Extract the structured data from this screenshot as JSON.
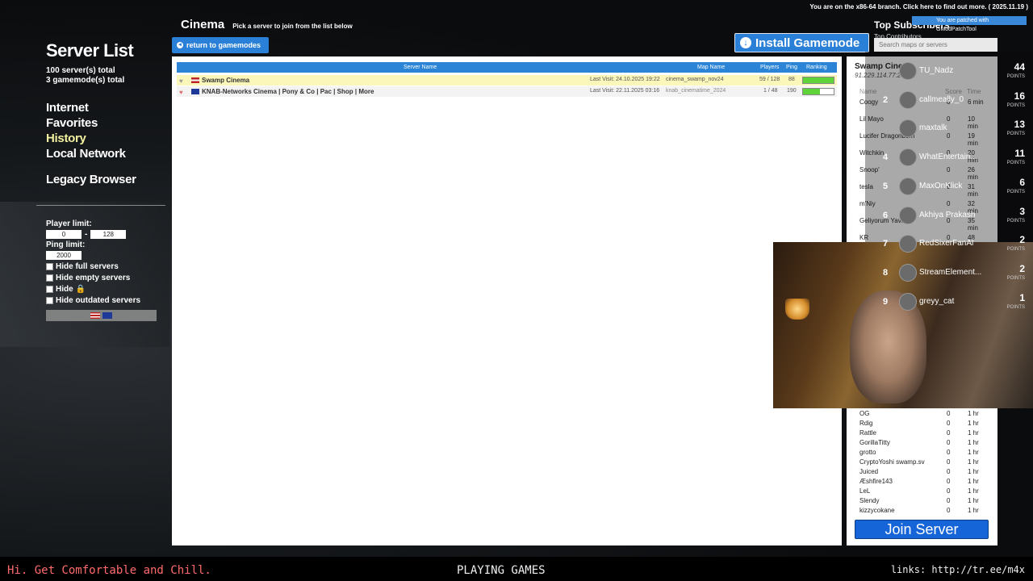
{
  "branch_notice": "You are on the x86-64 branch. Click here to find out more. ( 2025.11.19 )",
  "patched_notice": "You are patched with GModPatchTool",
  "sidebar": {
    "title": "Server List",
    "servers_total": "100 server(s) total",
    "gamemodes_total": "3 gamemode(s) total",
    "nav": [
      "Internet",
      "Favorites",
      "History",
      "Local Network"
    ],
    "active": "History",
    "legacy": "Legacy Browser"
  },
  "filters": {
    "player_limit_label": "Player limit:",
    "player_min": "0",
    "player_max": "128",
    "ping_limit_label": "Ping limit:",
    "ping_value": "2000",
    "options": [
      "Hide full servers",
      "Hide empty servers",
      "Hide",
      "Hide outdated servers"
    ]
  },
  "header": {
    "gamemode": "Cinema",
    "hint": "Pick a server to join from the list below",
    "return_label": "return to gamemodes",
    "install_label": "Install Gamemode"
  },
  "table": {
    "columns": {
      "name": "Server Name",
      "map": "Map Name",
      "players": "Players",
      "ping": "Ping",
      "ranking": "Ranking"
    },
    "rows": [
      {
        "name": "Swamp Cinema",
        "last_visit": "Last Visit: 24.10.2025 19:22",
        "map": "cinema_swamp_nov24",
        "players": "59 / 128",
        "ping": "88",
        "rank": 1.0
      },
      {
        "name": "KNAB-Networks Cinema | Pony & Co | Pac | Shop | More",
        "last_visit": "Last Visit: 22.11.2025 03:16",
        "map": "knab_cinematime_2024",
        "players": "1 / 48",
        "ping": "190",
        "rank": 0.55
      }
    ]
  },
  "server_panel": {
    "title": "Swamp Cinema",
    "ip": "91.229.114.77:27015",
    "columns": {
      "name": "Name",
      "score": "Score",
      "time": "Time"
    },
    "players_top": [
      {
        "name": "Coogy",
        "score": "0",
        "time": "6 min"
      },
      {
        "name": "Lil Mayo",
        "score": "0",
        "time": "10 min"
      },
      {
        "name": "Lucifer Dragonborn",
        "score": "0",
        "time": "19 min"
      },
      {
        "name": "Witchkin",
        "score": "0",
        "time": "20 min"
      },
      {
        "name": "Snoop'",
        "score": "0",
        "time": "26 min"
      },
      {
        "name": "tesla",
        "score": "0",
        "time": "31 min"
      },
      {
        "name": "m'Niy",
        "score": "0",
        "time": "32 min"
      },
      {
        "name": "Geliyorum Yavrum",
        "score": "0",
        "time": "35 min"
      },
      {
        "name": "KR",
        "score": "0",
        "time": "48 min"
      }
    ],
    "players_bottom": [
      {
        "name": "OG",
        "score": "0",
        "time": "1 hr"
      },
      {
        "name": "Rdig",
        "score": "0",
        "time": "1 hr"
      },
      {
        "name": "Rattle",
        "score": "0",
        "time": "1 hr"
      },
      {
        "name": "GorillaTitty",
        "score": "0",
        "time": "1 hr"
      },
      {
        "name": "grotto",
        "score": "0",
        "time": "1 hr"
      },
      {
        "name": "CryptoYoshi swamp.sv",
        "score": "0",
        "time": "1 hr"
      },
      {
        "name": "Juiced",
        "score": "0",
        "time": "1 hr"
      },
      {
        "name": "Æshfire143",
        "score": "0",
        "time": "1 hr"
      },
      {
        "name": "LeL",
        "score": "0",
        "time": "1 hr"
      },
      {
        "name": "Slendy",
        "score": "0",
        "time": "1 hr"
      },
      {
        "name": "kizzycokane",
        "score": "0",
        "time": "1 hr"
      }
    ],
    "join_label": "Join Server"
  },
  "search": {
    "placeholder": "Search maps or servers"
  },
  "subscribers": {
    "title": "Top Subscribers",
    "subtitle": "Top Contributors",
    "points_label": "POINTS",
    "items": [
      {
        "rank": "",
        "name": "TU_Nadz",
        "points": "44"
      },
      {
        "rank": "2",
        "name": "callmeally_0",
        "points": "16"
      },
      {
        "rank": "",
        "name": "maxtalk",
        "points": "13"
      },
      {
        "rank": "4",
        "name": "WhatEntertain...",
        "points": "11"
      },
      {
        "rank": "5",
        "name": "MaxOnKlick",
        "points": "6"
      },
      {
        "rank": "6",
        "name": "Akhiya Prakash",
        "points": "3"
      },
      {
        "rank": "7",
        "name": "RedSixerFanAl",
        "points": "2"
      },
      {
        "rank": "8",
        "name": "StreamElement...",
        "points": "2"
      },
      {
        "rank": "9",
        "name": "greyy_cat",
        "points": "1"
      }
    ]
  },
  "ticker": {
    "left": "Hi. Get Comfortable and Chill.",
    "middle": "PLAYING GAMES",
    "right": "links: http://tr.ee/m4x"
  }
}
